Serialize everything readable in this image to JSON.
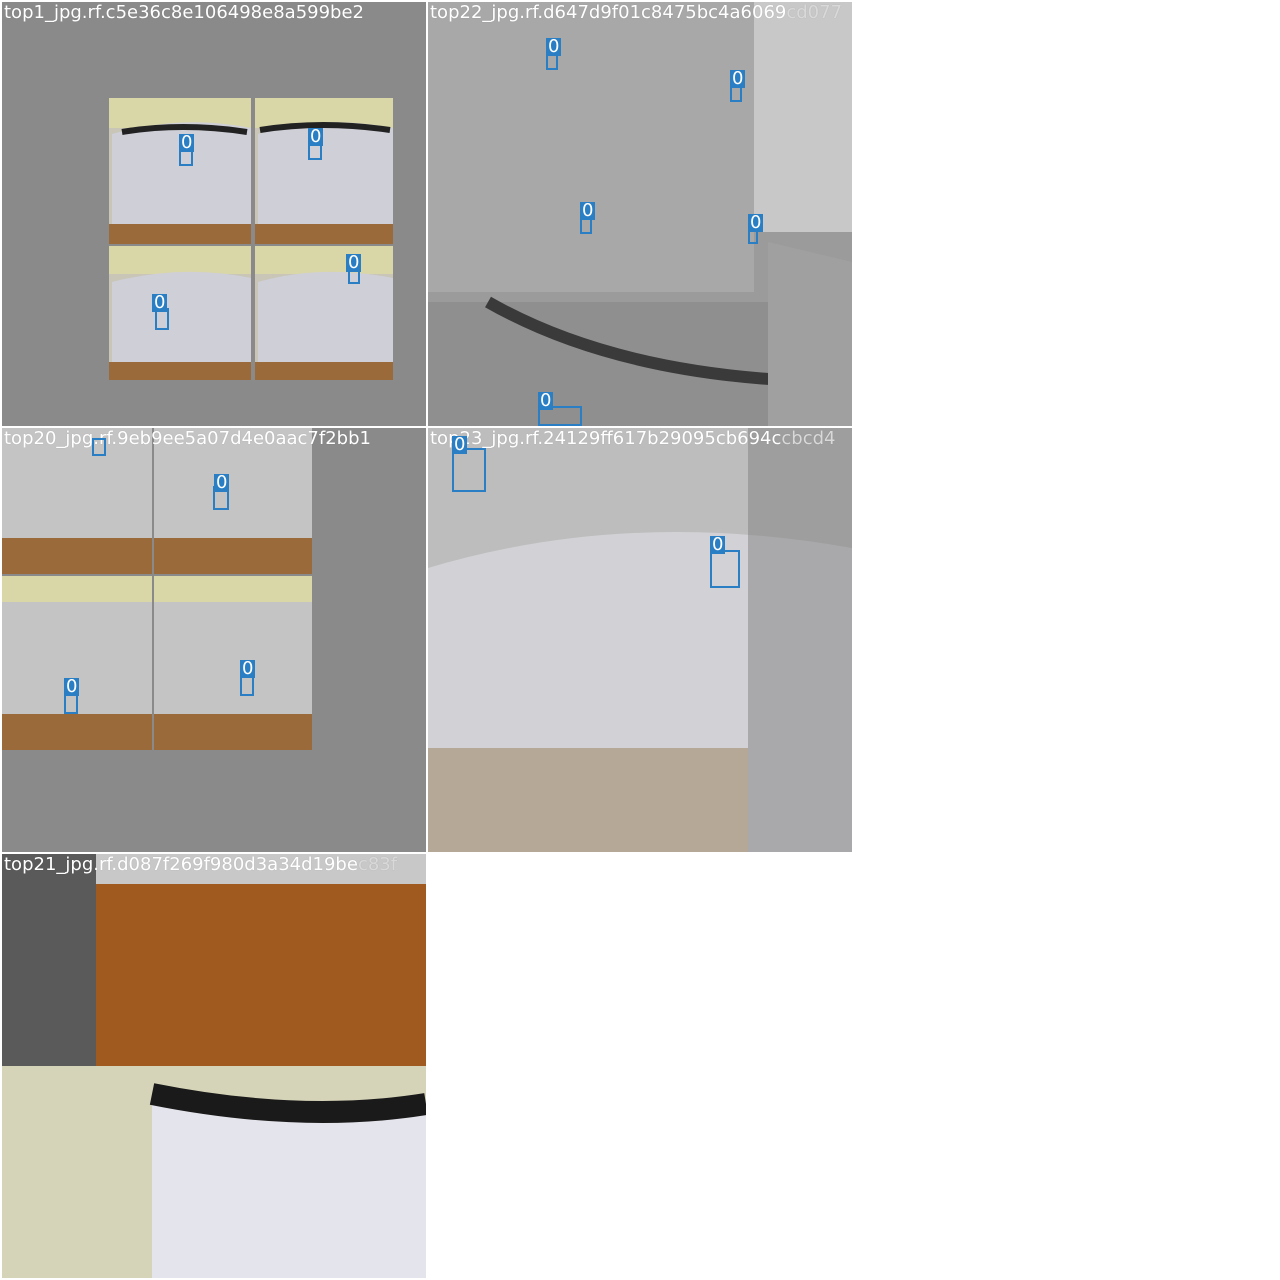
{
  "colors": {
    "cell_background": "#8a8a8a",
    "box_color": "#2a7fc4",
    "title_color": "#ffffff"
  },
  "cells": [
    {
      "title": "top1_jpg.rf.c5e36c8e106498e8a599be2",
      "title_overflow": ""
    },
    {
      "title": "top22_jpg.rf.d647d9f01c8475bc4a6069",
      "title_overflow": "cd077"
    },
    {
      "title": "top20_jpg.rf.9eb9ee5a07d4e0aac7f2bb1",
      "title_overflow": ""
    },
    {
      "title": "top23_jpg.rf.24129ff617b29095cb694c",
      "title_overflow": "cbcd4"
    },
    {
      "title": "top21_jpg.rf.d087f269f980d3a34d19be",
      "title_overflow": "c83f"
    }
  ],
  "box_label": "0"
}
